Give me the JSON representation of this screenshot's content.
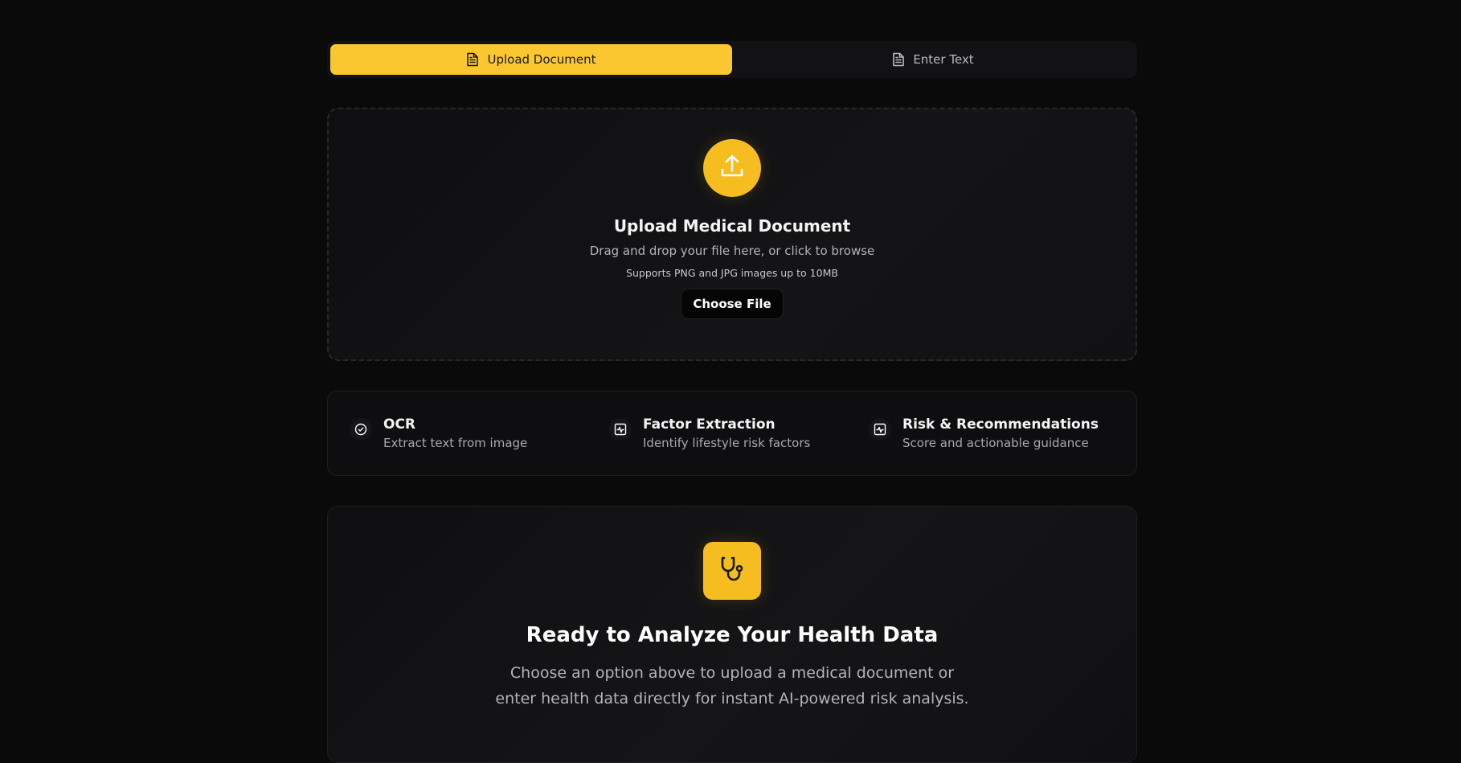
{
  "tabs": {
    "upload_label": "Upload Document",
    "text_label": "Enter Text",
    "active": "upload"
  },
  "upload": {
    "title": "Upload Medical Document",
    "subtitle": "Drag and drop your file here, or click to browse",
    "hint": "Supports PNG and JPG images up to 10MB",
    "button_label": "Choose File",
    "icon": "upload-icon"
  },
  "features": [
    {
      "title": "OCR",
      "desc": "Extract text from image",
      "icon": "check-circle-icon"
    },
    {
      "title": "Factor Extraction",
      "desc": "Identify lifestyle risk factors",
      "icon": "activity-icon"
    },
    {
      "title": "Risk & Recommendations",
      "desc": "Score and actionable guidance",
      "icon": "activity-icon"
    }
  ],
  "ready": {
    "title": "Ready to Analyze Your Health Data",
    "text": "Choose an option above to upload a medical document or enter health data directly for instant AI-powered risk analysis.",
    "icon": "stethoscope-icon"
  },
  "colors": {
    "accent": "#fac730",
    "background": "#0a0a0b"
  }
}
